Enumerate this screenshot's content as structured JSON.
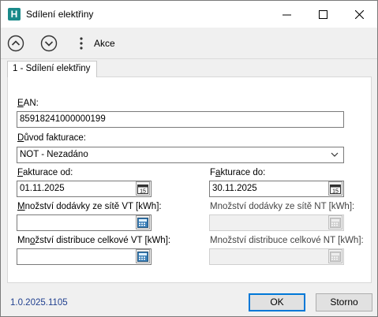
{
  "window": {
    "title": "Sdílení elektřiny",
    "app_icon": "H"
  },
  "toolbar": {
    "akce_label": "Akce"
  },
  "tabs": [
    {
      "label": "1 - Sdílení elektřiny"
    }
  ],
  "form": {
    "ean": {
      "label_u": "E",
      "label_rest": "AN:",
      "value": "85918241000000199"
    },
    "duvod": {
      "label_u": "D",
      "label_rest": "ůvod fakturace:",
      "value": "NOT - Nezadáno"
    },
    "fakturace_od": {
      "label_u": "F",
      "label_rest": "akturace od:",
      "value": "01.11.2025"
    },
    "fakturace_do": {
      "label_pre": "F",
      "label_u": "a",
      "label_rest": "kturace do:",
      "value": "30.11.2025"
    },
    "mnozstvi_dodavky_vt": {
      "label_u": "M",
      "label_rest": "nožství dodávky ze sítě VT [kWh]:",
      "value": ""
    },
    "mnozstvi_dodavky_nt": {
      "label": "Množství dodávky ze sítě NT [kWh]:",
      "value": ""
    },
    "mnozstvi_distribuce_vt": {
      "label_pre": "Mn",
      "label_u": "o",
      "label_rest": "žství distribuce celkové VT [kWh]:",
      "value": ""
    },
    "mnozstvi_distribuce_nt": {
      "label": "Množství distribuce celkové NT [kWh]:",
      "value": ""
    },
    "calendar_day": "15"
  },
  "footer": {
    "version": "1.0.2025.1105",
    "ok_label": "OK",
    "cancel_label": "Storno"
  },
  "colors": {
    "accent": "#0078d7",
    "app_icon_bg": "#1a8a8a",
    "version_text": "#1f3f8f"
  }
}
